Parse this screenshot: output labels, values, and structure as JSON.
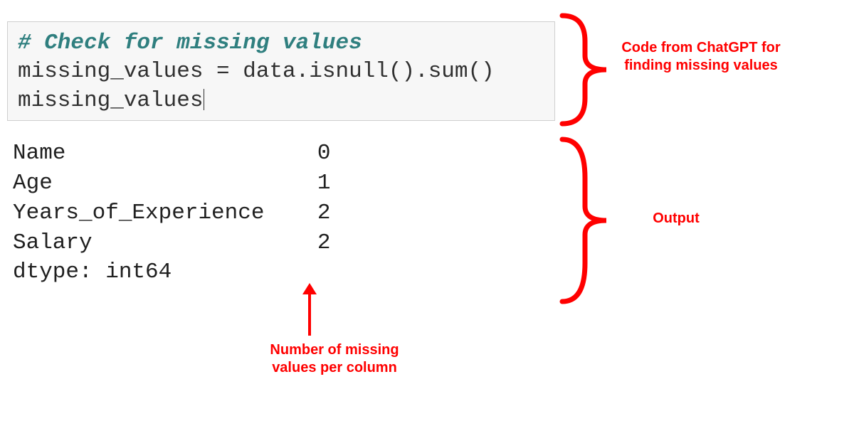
{
  "code": {
    "comment": "# Check for missing values",
    "line1": "missing_values = data.isnull().sum()",
    "line2": "missing_values"
  },
  "output": {
    "rows": [
      {
        "label": "Name",
        "value": "0"
      },
      {
        "label": "Age",
        "value": "1"
      },
      {
        "label": "Years_of_Experience",
        "value": "2"
      },
      {
        "label": "Salary",
        "value": "2"
      }
    ],
    "dtype_line": "dtype: int64"
  },
  "annotations": {
    "code_label": "Code from ChatGPT for finding missing values",
    "output_label": "Output",
    "missing_label": "Number of missing values per column"
  },
  "colors": {
    "annotation": "#ff0000",
    "comment": "#2f7f7f",
    "cell_bg": "#f7f7f7",
    "cell_border": "#cfcfcf"
  }
}
